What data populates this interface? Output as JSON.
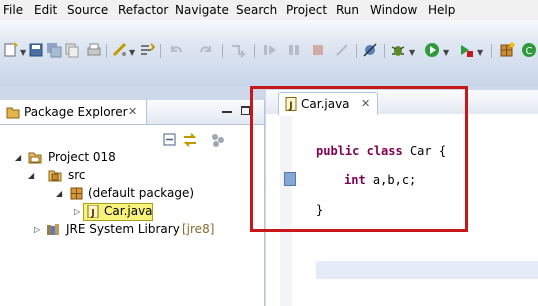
{
  "menu": [
    "File",
    "Edit",
    "Source",
    "Refactor",
    "Navigate",
    "Search",
    "Project",
    "Run",
    "Window",
    "Help"
  ],
  "package_explorer": {
    "title": "Package Explorer",
    "tree": {
      "project": "Project 018",
      "src": "src",
      "package": "(default package)",
      "file": "Car.java",
      "library": "JRE System Library",
      "library_suffix": "[jre8]"
    }
  },
  "editor": {
    "tab_label": "Car.java",
    "code": {
      "line1_kw1": "public",
      "line1_kw2": "class",
      "line1_rest": "Car {",
      "line2_kw": "int",
      "line2_rest": "a,b,c;",
      "line3": "}"
    }
  },
  "colors": {
    "highlight": "#c8171b",
    "selection": "#f6f27a",
    "keyword": "#7f0055"
  }
}
